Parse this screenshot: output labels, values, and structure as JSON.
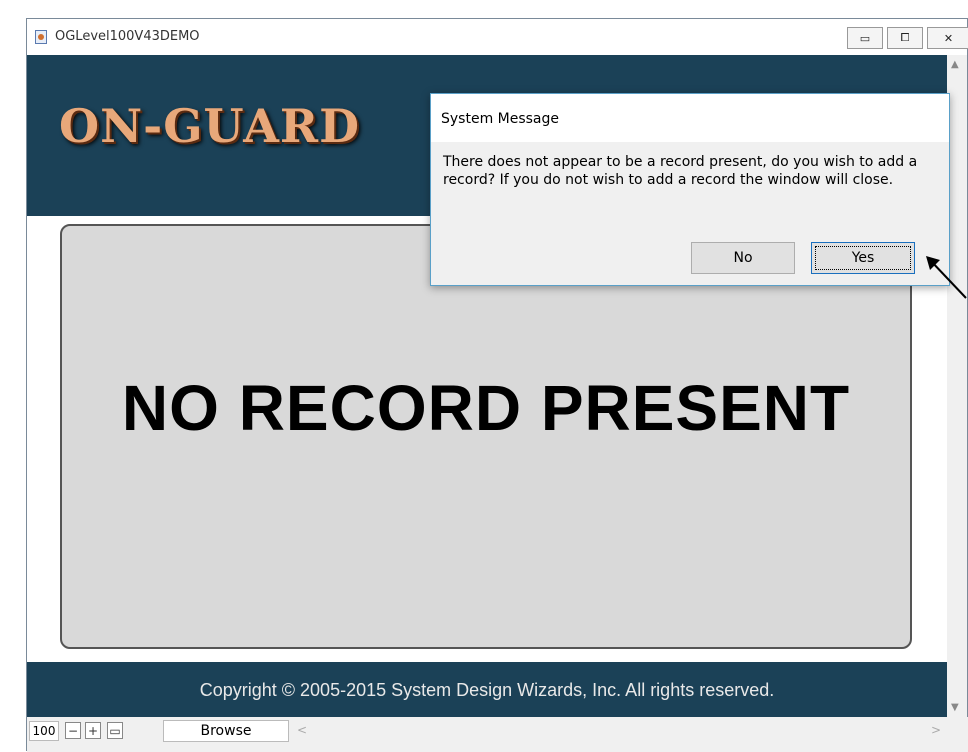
{
  "window": {
    "title": "OGLevel100V43DEMO",
    "controls": {
      "minimize": "▭",
      "maximize": "⧠",
      "close": "✕"
    }
  },
  "header": {
    "logo_text": "ON-GUARD"
  },
  "main": {
    "message": "NO RECORD PRESENT"
  },
  "footer": {
    "copyright": "Copyright © 2005-2015 System Design Wizards, Inc. All rights reserved."
  },
  "statusbar": {
    "zoom": "100",
    "mode": "Browse"
  },
  "dialog": {
    "title": "System Message",
    "message": "There does not appear to be a record present, do you wish to add a record? If you do not wish to add a record the window will close.",
    "no_label": "No",
    "yes_label": "Yes"
  },
  "colors": {
    "band": "#1b4157",
    "panel": "#d9d9d9",
    "logo": "#e8a87a"
  }
}
